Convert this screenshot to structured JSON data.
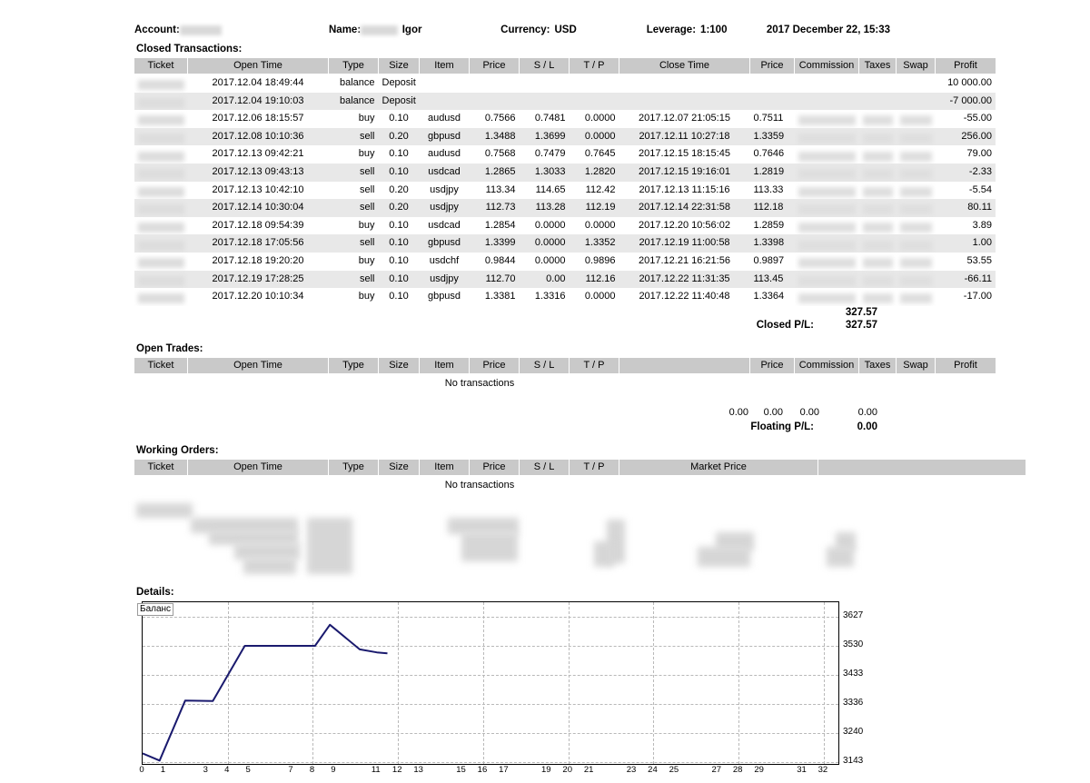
{
  "header": {
    "account_label": "Account:",
    "account_value": "",
    "name_label": "Name:",
    "name_value": "Igor",
    "currency_label": "Currency:",
    "currency_value": "USD",
    "leverage_label": "Leverage:",
    "leverage_value": "1:100",
    "datetime": "2017 December 22, 15:33"
  },
  "closed": {
    "title": "Closed Transactions:",
    "columns": [
      "Ticket",
      "Open Time",
      "Type",
      "Size",
      "Item",
      "Price",
      "S / L",
      "T / P",
      "Close Time",
      "Price",
      "Commission",
      "Taxes",
      "Swap",
      "Profit"
    ],
    "rows": [
      {
        "ticket": "",
        "open_time": "2017.12.04 18:49:44",
        "type": "balance",
        "size": "Deposit",
        "item": "",
        "price": "",
        "sl": "",
        "tp": "",
        "close_time": "",
        "price2": "",
        "commission": "",
        "taxes": "",
        "swap": "",
        "profit": "10 000.00"
      },
      {
        "ticket": "",
        "open_time": "2017.12.04 19:10:03",
        "type": "balance",
        "size": "Deposit",
        "item": "",
        "price": "",
        "sl": "",
        "tp": "",
        "close_time": "",
        "price2": "",
        "commission": "",
        "taxes": "",
        "swap": "",
        "profit": "-7 000.00"
      },
      {
        "ticket": "",
        "open_time": "2017.12.06 18:15:57",
        "type": "buy",
        "size": "0.10",
        "item": "audusd",
        "price": "0.7566",
        "sl": "0.7481",
        "tp": "0.0000",
        "close_time": "2017.12.07 21:05:15",
        "price2": "0.7511",
        "commission": "",
        "taxes": "",
        "swap": "",
        "profit": "-55.00"
      },
      {
        "ticket": "",
        "open_time": "2017.12.08 10:10:36",
        "type": "sell",
        "size": "0.20",
        "item": "gbpusd",
        "price": "1.3488",
        "sl": "1.3699",
        "tp": "0.0000",
        "close_time": "2017.12.11 10:27:18",
        "price2": "1.3359",
        "commission": "",
        "taxes": "",
        "swap": "",
        "profit": "256.00"
      },
      {
        "ticket": "",
        "open_time": "2017.12.13 09:42:21",
        "type": "buy",
        "size": "0.10",
        "item": "audusd",
        "price": "0.7568",
        "sl": "0.7479",
        "tp": "0.7645",
        "close_time": "2017.12.15 18:15:45",
        "price2": "0.7646",
        "commission": "",
        "taxes": "",
        "swap": "",
        "profit": "79.00"
      },
      {
        "ticket": "",
        "open_time": "2017.12.13 09:43:13",
        "type": "sell",
        "size": "0.10",
        "item": "usdcad",
        "price": "1.2865",
        "sl": "1.3033",
        "tp": "1.2820",
        "close_time": "2017.12.15 19:16:01",
        "price2": "1.2819",
        "commission": "",
        "taxes": "",
        "swap": "",
        "profit": "-2.33"
      },
      {
        "ticket": "",
        "open_time": "2017.12.13 10:42:10",
        "type": "sell",
        "size": "0.20",
        "item": "usdjpy",
        "price": "113.34",
        "sl": "114.65",
        "tp": "112.42",
        "close_time": "2017.12.13 11:15:16",
        "price2": "113.33",
        "commission": "",
        "taxes": "",
        "swap": "",
        "profit": "-5.54"
      },
      {
        "ticket": "",
        "open_time": "2017.12.14 10:30:04",
        "type": "sell",
        "size": "0.20",
        "item": "usdjpy",
        "price": "112.73",
        "sl": "113.28",
        "tp": "112.19",
        "close_time": "2017.12.14 22:31:58",
        "price2": "112.18",
        "commission": "",
        "taxes": "",
        "swap": "",
        "profit": "80.11"
      },
      {
        "ticket": "",
        "open_time": "2017.12.18 09:54:39",
        "type": "buy",
        "size": "0.10",
        "item": "usdcad",
        "price": "1.2854",
        "sl": "0.0000",
        "tp": "0.0000",
        "close_time": "2017.12.20 10:56:02",
        "price2": "1.2859",
        "commission": "",
        "taxes": "",
        "swap": "",
        "profit": "3.89"
      },
      {
        "ticket": "",
        "open_time": "2017.12.18 17:05:56",
        "type": "sell",
        "size": "0.10",
        "item": "gbpusd",
        "price": "1.3399",
        "sl": "0.0000",
        "tp": "1.3352",
        "close_time": "2017.12.19 11:00:58",
        "price2": "1.3398",
        "commission": "",
        "taxes": "",
        "swap": "",
        "profit": "1.00"
      },
      {
        "ticket": "",
        "open_time": "2017.12.18 19:20:20",
        "type": "buy",
        "size": "0.10",
        "item": "usdchf",
        "price": "0.9844",
        "sl": "0.0000",
        "tp": "0.9896",
        "close_time": "2017.12.21 16:21:56",
        "price2": "0.9897",
        "commission": "",
        "taxes": "",
        "swap": "",
        "profit": "53.55"
      },
      {
        "ticket": "",
        "open_time": "2017.12.19 17:28:25",
        "type": "sell",
        "size": "0.10",
        "item": "usdjpy",
        "price": "112.70",
        "sl": "0.00",
        "tp": "112.16",
        "close_time": "2017.12.22 11:31:35",
        "price2": "113.45",
        "commission": "",
        "taxes": "",
        "swap": "",
        "profit": "-66.11"
      },
      {
        "ticket": "",
        "open_time": "2017.12.20 10:10:34",
        "type": "buy",
        "size": "0.10",
        "item": "gbpusd",
        "price": "1.3381",
        "sl": "1.3316",
        "tp": "0.0000",
        "close_time": "2017.12.22 11:40:48",
        "price2": "1.3364",
        "commission": "",
        "taxes": "",
        "swap": "",
        "profit": "-17.00"
      }
    ],
    "subtotal_profit": "327.57",
    "total_label": "Closed P/L:",
    "total_value": "327.57"
  },
  "open_trades": {
    "title": "Open Trades:",
    "columns": [
      "Ticket",
      "Open Time",
      "Type",
      "Size",
      "Item",
      "Price",
      "S / L",
      "T / P",
      "",
      "Price",
      "Commission",
      "Taxes",
      "Swap",
      "Profit"
    ],
    "empty_text": "No transactions",
    "totals": {
      "commission": "0.00",
      "taxes": "0.00",
      "swap": "0.00",
      "profit": "0.00"
    },
    "total_label": "Floating P/L:",
    "total_value": "0.00"
  },
  "working_orders": {
    "title": "Working Orders:",
    "columns": [
      "Ticket",
      "Open Time",
      "Type",
      "Size",
      "Item",
      "Price",
      "S / L",
      "T / P",
      "Market Price",
      ""
    ],
    "empty_text": "No transactions"
  },
  "details": {
    "title": "Details:"
  },
  "chart_data": {
    "type": "line",
    "title": "",
    "legend": "Баланс",
    "legend_position": "top-left",
    "grid": true,
    "xlabel": "",
    "ylabel": "",
    "x_ticks": [
      0,
      1,
      3,
      4,
      5,
      7,
      8,
      9,
      11,
      12,
      13,
      15,
      16,
      17,
      19,
      20,
      21,
      23,
      24,
      25,
      27,
      28,
      29,
      31,
      32
    ],
    "y_ticks": [
      3143,
      3240,
      3336,
      3433,
      3530,
      3627
    ],
    "ylim": [
      3143,
      3675
    ],
    "xlim": [
      0,
      32.6
    ],
    "series": [
      {
        "name": "Баланс",
        "color": "#1a1a6e",
        "x": [
          0,
          0.8,
          2.0,
          3.3,
          4.8,
          8.1,
          8.8,
          10.2,
          11.0,
          11.5
        ],
        "y": [
          3172,
          3148,
          3348,
          3346,
          3530,
          3530,
          3600,
          3518,
          3508,
          3505
        ]
      }
    ]
  }
}
